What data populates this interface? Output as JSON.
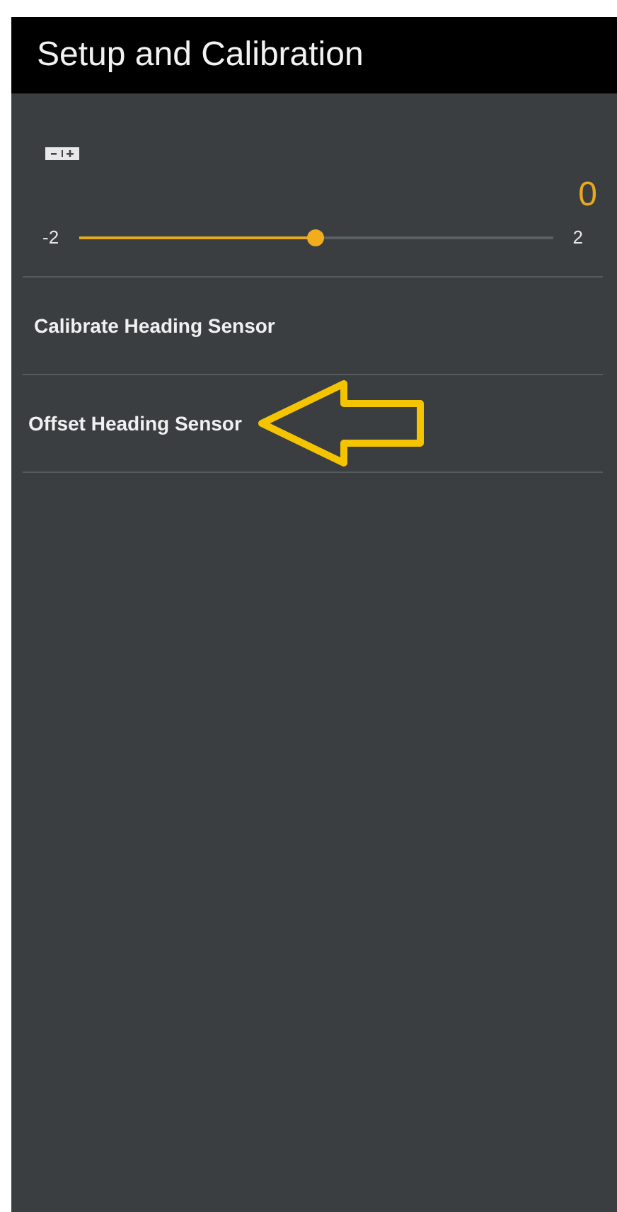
{
  "header": {
    "title": "Setup and Calibration"
  },
  "slider": {
    "reading": "0",
    "min_label": "-2",
    "max_label": "2",
    "level": 0.5
  },
  "menu_items": [
    {
      "label": "Calibrate Heading Sensor",
      "pointed": false
    },
    {
      "label": "Offset Heading Sensor",
      "pointed": true
    }
  ]
}
